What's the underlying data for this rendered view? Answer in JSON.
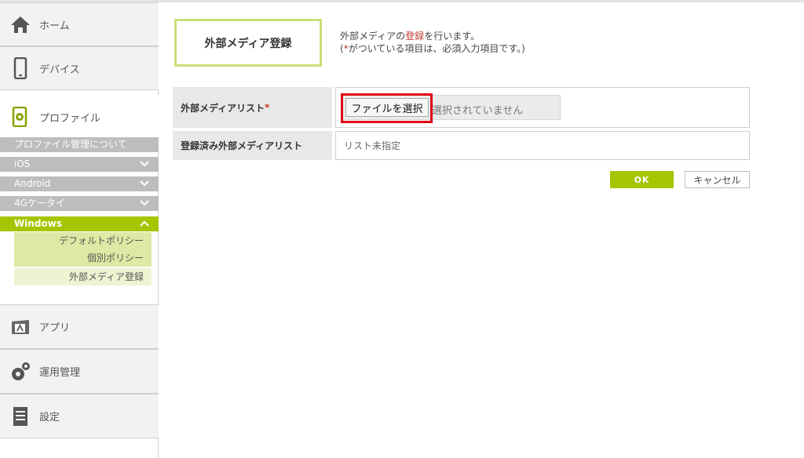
{
  "sidebar": {
    "nav": {
      "home": "ホーム",
      "device": "デバイス",
      "profile": "プロファイル",
      "app": "アプリ",
      "operation": "運用管理",
      "settings": "設定"
    },
    "profile_sub": {
      "about": "プロファイル管理について",
      "ios": "iOS",
      "android": "Android",
      "keitai": "4Gケータイ",
      "windows": "Windows",
      "default_policy": "デフォルトポリシー",
      "individual_policy": "個別ポリシー",
      "external_media": "外部メディア登録"
    }
  },
  "main": {
    "title": "外部メディア登録",
    "desc_pre": "外部メディアの",
    "desc_red": "登録",
    "desc_post": "を行います。",
    "desc2_pre": "(",
    "desc2_red": "*",
    "desc2_post": "がついている項目は、必須入力項目です。)",
    "rows": [
      {
        "label": "外部メディアリスト",
        "required": "*"
      },
      {
        "label": "登録済み外部メディアリスト",
        "value": "リスト未指定"
      }
    ],
    "file_button": "ファイルを選択",
    "file_status": "選択されていません",
    "ok": "OK",
    "cancel": "キャンセル"
  },
  "colors": {
    "accent": "#a6c400",
    "highlight": "#e00016",
    "required": "#c0392b"
  }
}
